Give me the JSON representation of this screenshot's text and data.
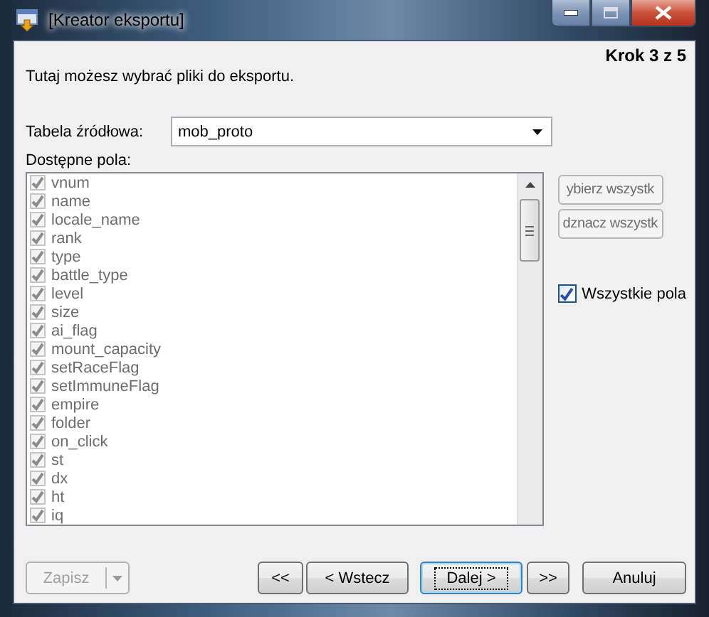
{
  "window": {
    "title": "[Kreator eksportu]"
  },
  "step": "Krok 3 z 5",
  "description": "Tutaj możesz wybrać pliki do eksportu.",
  "source_table": {
    "label": "Tabela źródłowa:",
    "value": "mob_proto"
  },
  "fields": {
    "label": "Dostępne pola:",
    "items": [
      {
        "name": "vnum",
        "checked": true,
        "disabled": true
      },
      {
        "name": "name",
        "checked": true,
        "disabled": true
      },
      {
        "name": "locale_name",
        "checked": true,
        "disabled": true
      },
      {
        "name": "rank",
        "checked": true,
        "disabled": true
      },
      {
        "name": "type",
        "checked": true,
        "disabled": true
      },
      {
        "name": "battle_type",
        "checked": true,
        "disabled": true
      },
      {
        "name": "level",
        "checked": true,
        "disabled": true
      },
      {
        "name": "size",
        "checked": true,
        "disabled": true
      },
      {
        "name": "ai_flag",
        "checked": true,
        "disabled": true
      },
      {
        "name": "mount_capacity",
        "checked": true,
        "disabled": true
      },
      {
        "name": "setRaceFlag",
        "checked": true,
        "disabled": true
      },
      {
        "name": "setImmuneFlag",
        "checked": true,
        "disabled": true
      },
      {
        "name": "empire",
        "checked": true,
        "disabled": true
      },
      {
        "name": "folder",
        "checked": true,
        "disabled": true
      },
      {
        "name": "on_click",
        "checked": true,
        "disabled": true
      },
      {
        "name": "st",
        "checked": true,
        "disabled": true
      },
      {
        "name": "dx",
        "checked": true,
        "disabled": true
      },
      {
        "name": "ht",
        "checked": true,
        "disabled": true
      },
      {
        "name": "iq",
        "checked": true,
        "disabled": true
      }
    ]
  },
  "side_buttons": [
    {
      "label": "ybierz wszystk"
    },
    {
      "label": "dznacz wszystk"
    }
  ],
  "all_fields": {
    "label": "Wszystkie pola",
    "checked": true,
    "disabled": false
  },
  "buttons": [
    {
      "label": "Zapisz",
      "kind": "split",
      "disabled": true,
      "default": false
    },
    {
      "label": "<<",
      "kind": "nav",
      "disabled": false,
      "default": false
    },
    {
      "label": "< Wstecz",
      "kind": "nav",
      "disabled": false,
      "default": false
    },
    {
      "label": "Dalej >",
      "kind": "nav",
      "disabled": false,
      "default": true
    },
    {
      "label": ">>",
      "kind": "nav",
      "disabled": false,
      "default": false
    },
    {
      "label": "Anuluj",
      "kind": "cancel",
      "disabled": false,
      "default": false
    }
  ]
}
